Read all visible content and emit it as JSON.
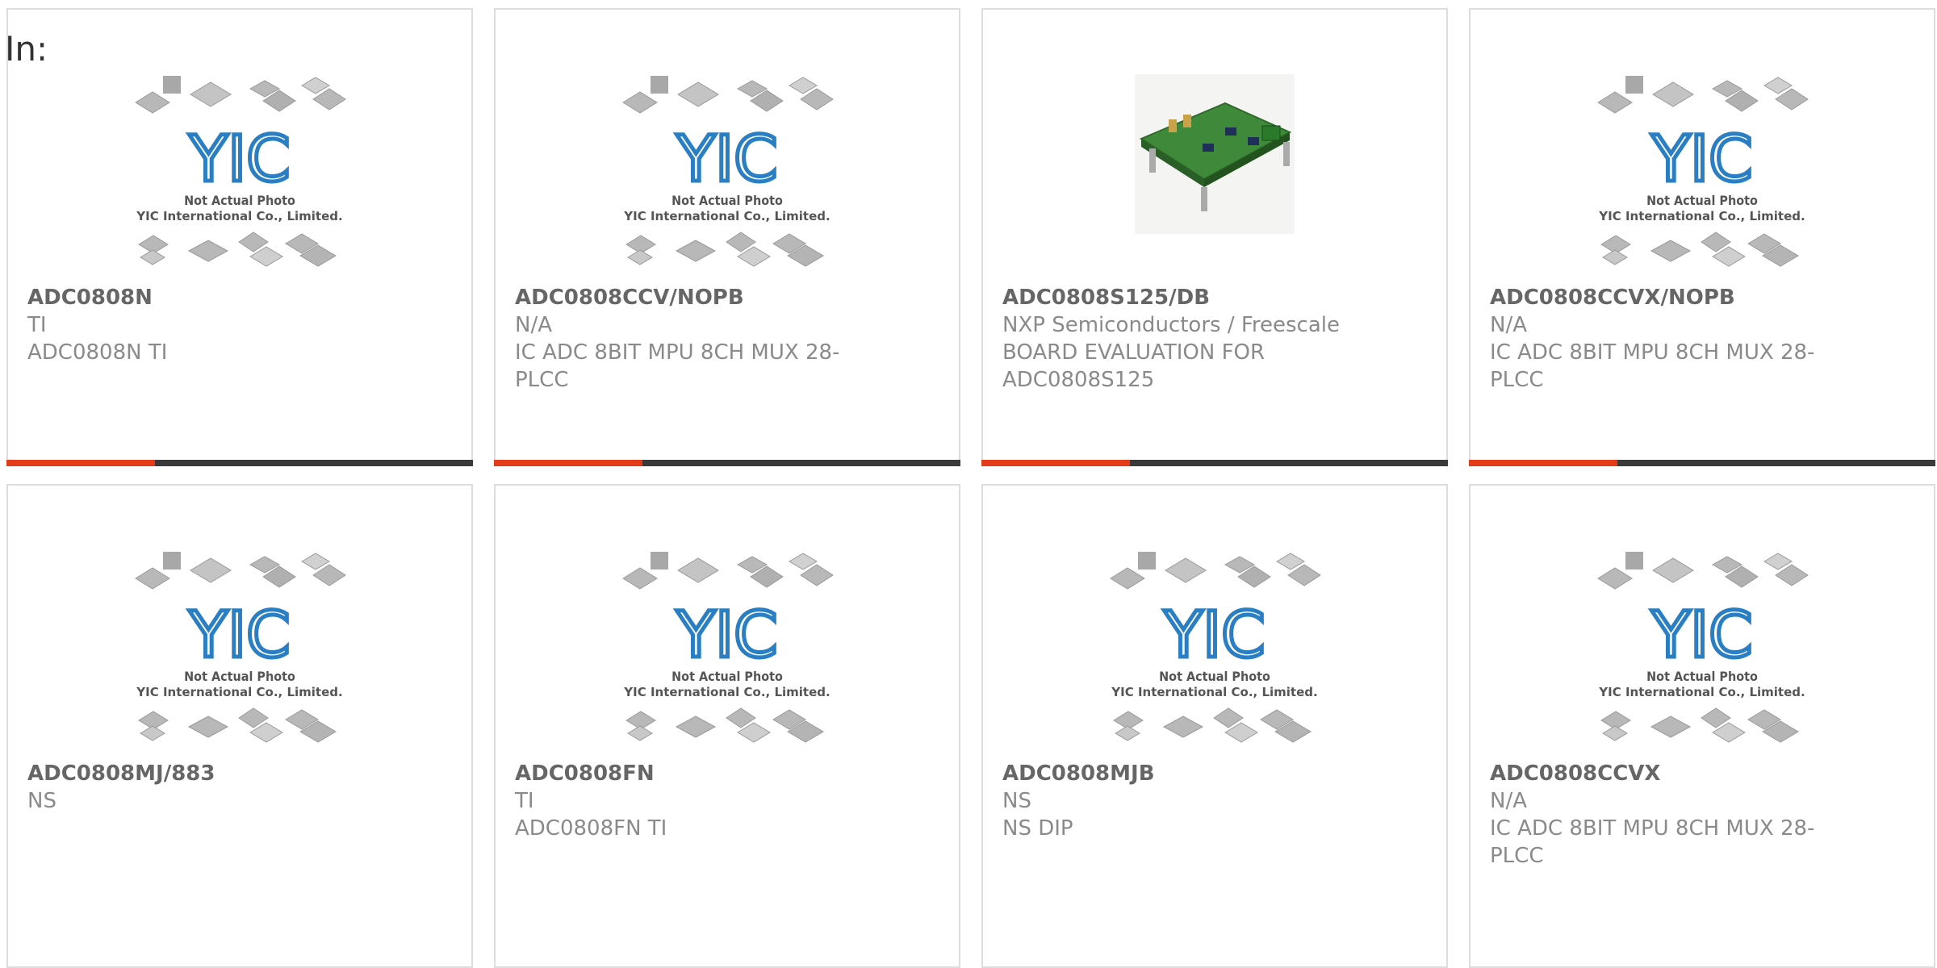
{
  "header": {
    "label": "In:"
  },
  "watermark": {
    "logo": "YIC",
    "line1": "Not Actual Photo",
    "line2": "YIC International Co., Limited."
  },
  "colors": {
    "accent": "#e23c1a",
    "bar": "#3a3a3a",
    "logo_blue": "#2a7fc4",
    "card_border": "#dddddd"
  },
  "products": [
    {
      "part": "ADC0808N",
      "manufacturer": "TI",
      "description": "ADC0808N TI",
      "image": "placeholder-photo"
    },
    {
      "part": "ADC0808CCV/NOPB",
      "manufacturer": "N/A",
      "description": "IC ADC 8BIT MPU 8CH MUX 28-PLCC",
      "image": "placeholder-photo"
    },
    {
      "part": "ADC0808S125/DB",
      "manufacturer": "NXP Semiconductors / Freescale",
      "description": "BOARD EVALUATION FOR ADC0808S125",
      "image": "evaluation-board-photo"
    },
    {
      "part": "ADC0808CCVX/NOPB",
      "manufacturer": "N/A",
      "description": "IC ADC 8BIT MPU 8CH MUX 28-PLCC",
      "image": "placeholder-photo"
    },
    {
      "part": "ADC0808MJ/883",
      "manufacturer": "NS",
      "description": "",
      "image": "placeholder-photo"
    },
    {
      "part": "ADC0808FN",
      "manufacturer": "TI",
      "description": "ADC0808FN TI",
      "image": "placeholder-photo"
    },
    {
      "part": "ADC0808MJB",
      "manufacturer": "NS",
      "description": "NS DIP",
      "image": "placeholder-photo"
    },
    {
      "part": "ADC0808CCVX",
      "manufacturer": "N/A",
      "description": "IC ADC 8BIT MPU 8CH MUX 28-PLCC",
      "image": "placeholder-photo"
    }
  ]
}
